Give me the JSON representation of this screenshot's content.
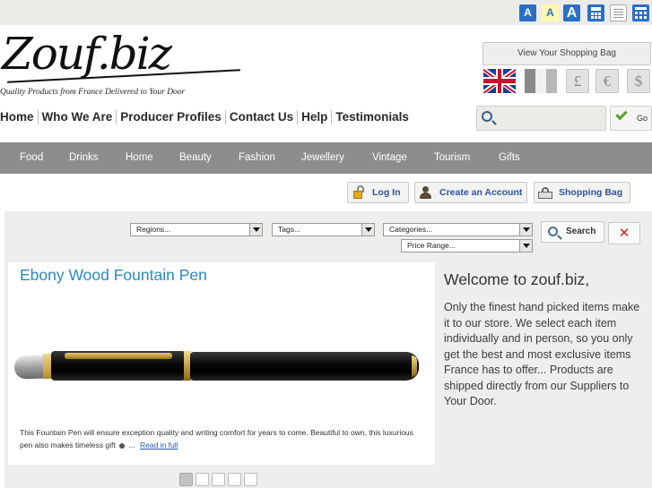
{
  "accessibility": {
    "text_small": "A",
    "text_normal": "A",
    "text_large": "A",
    "icons": [
      "calculator-icon",
      "text-only-icon",
      "sitemap-icon"
    ],
    "accent": "#2b6fc5"
  },
  "logo": {
    "text": "Zouf.biz",
    "tagline": "Quality Products from France Delivered to Your Door"
  },
  "header": {
    "view_bag_label": "View Your Shopping Bag",
    "languages": [
      "english-flag-icon",
      "french-flag-icon"
    ],
    "currencies": [
      "£",
      "€",
      "$"
    ]
  },
  "main_nav": [
    "Home",
    "Who We Are",
    "Producer Profiles",
    "Contact Us",
    "Help",
    "Testimonials"
  ],
  "search": {
    "value": "",
    "go_label": "Go"
  },
  "categories": [
    "Food",
    "Drinks",
    "Home",
    "Beauty",
    "Fashion",
    "Jewellery",
    "Vintage",
    "Tourism",
    "Gifts"
  ],
  "account": {
    "login_label": "Log In",
    "create_label": "Create an Account",
    "bag_label": "Shopping Bag"
  },
  "filters": {
    "regions": "Regions...",
    "tags": "Tags...",
    "categories": "Categories...",
    "price_range": "Price Range...",
    "search_label": "Search",
    "clear_icon": "close-icon"
  },
  "featured": {
    "title": "Ebony Wood Fountain Pen",
    "description": "This Fountain Pen will ensure exception quality and writing comfort for years to come. Beautiful to own, this luxurious pen also makes timeless gift",
    "ellipsis": "...",
    "read_more": "Read in full",
    "slide_count": 5,
    "active_slide": 1
  },
  "welcome": {
    "title": "Welcome to zouf.biz,",
    "body": "Only the finest hand picked items make it to our store. We select each item individually and in person, so you only get the best and most exclusive items France has to offer... Products are shipped directly from our Suppliers to Your Door."
  },
  "colors": {
    "category_bar": "#8d8d8b",
    "link_blue": "#2b55a0",
    "title_blue": "#2a8ac0",
    "panel_bg": "#eeeeec"
  }
}
